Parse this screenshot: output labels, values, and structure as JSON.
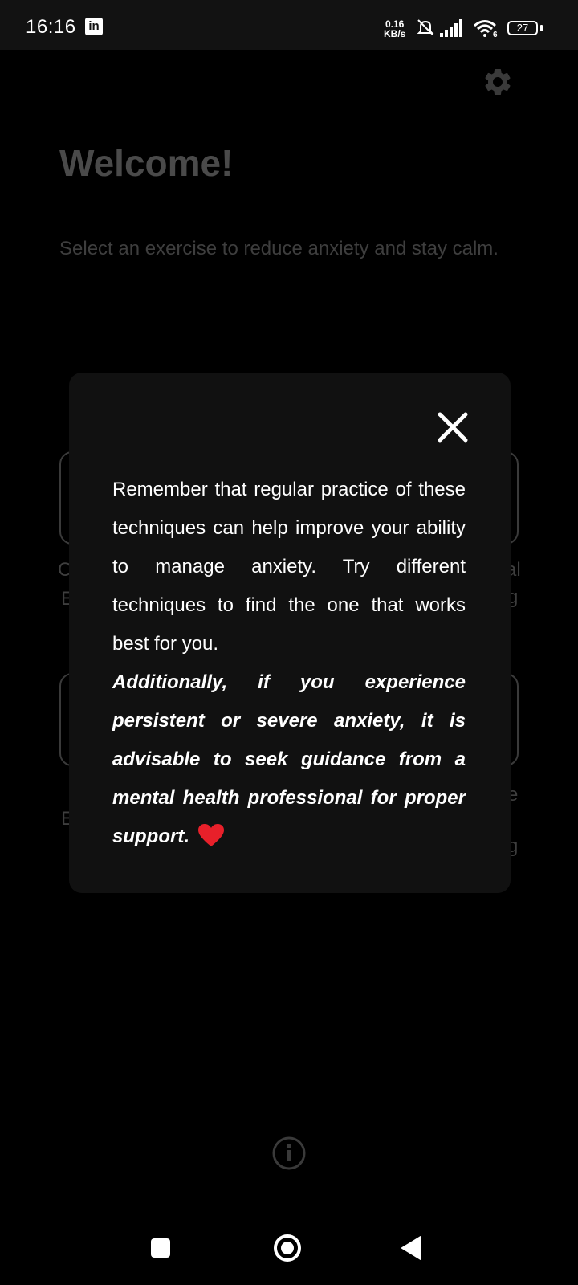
{
  "status_bar": {
    "time": "16:16",
    "linkedin_label": "in",
    "net_speed_value": "0.16",
    "net_speed_unit": "KB/s",
    "wifi_badge": "6",
    "battery": "27"
  },
  "header": {
    "title": "Welcome!",
    "subtitle": "Select an exercise to reduce anxiety and stay calm."
  },
  "background_labels": {
    "left_top_1": "C",
    "left_top_2": "E",
    "right_top_1": "al",
    "right_top_2": "g",
    "left_bottom_1": "E",
    "right_bottom_1": "e",
    "right_bottom_2": "g"
  },
  "modal": {
    "paragraph": "Remember that regular practice of these techniques can help improve your ability to manage anxiety. Try different techniques to find the one that works best for you.",
    "advice": "Additionally, if you experience persistent or severe anxiety, it is advisable to seek guidance from a mental health professional for proper support.",
    "heart_color": "#e8202a"
  },
  "icons": {
    "settings": "gear-icon",
    "close": "close-icon",
    "info": "info-icon",
    "nav_recents": "square-icon",
    "nav_home": "circle-icon",
    "nav_back": "triangle-back-icon"
  }
}
